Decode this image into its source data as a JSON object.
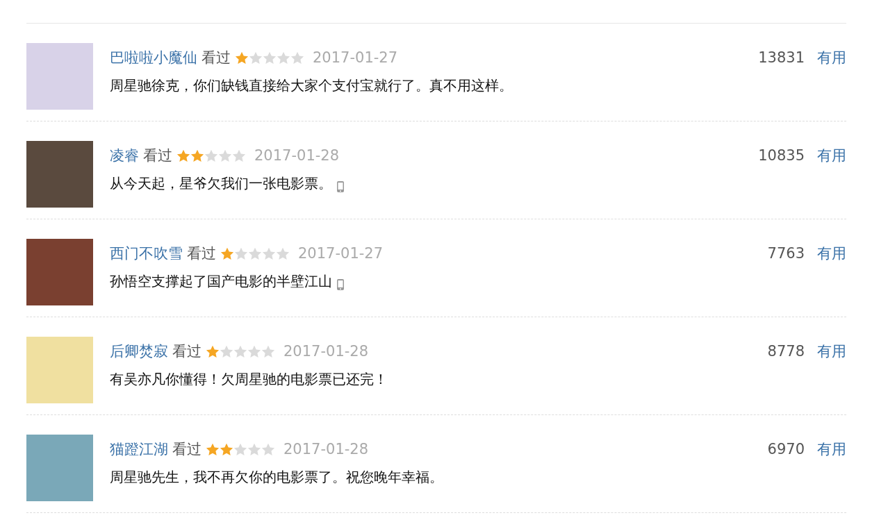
{
  "comments": [
    {
      "user": "巴啦啦小魔仙",
      "status": "看过",
      "stars": 1,
      "date": "2017-01-27",
      "votes": "13831",
      "useful": "有用",
      "text": "周星驰徐克，你们缺钱直接给大家个支付宝就行了。真不用这样。",
      "mobile": false
    },
    {
      "user": "凌睿",
      "status": "看过",
      "stars": 2,
      "date": "2017-01-28",
      "votes": "10835",
      "useful": "有用",
      "text": "从今天起，星爷欠我们一张电影票。",
      "mobile": true
    },
    {
      "user": "西门不吹雪",
      "status": "看过",
      "stars": 1,
      "date": "2017-01-27",
      "votes": "7763",
      "useful": "有用",
      "text": "孙悟空支撑起了国产电影的半壁江山",
      "mobile": true
    },
    {
      "user": "后卿焚寂",
      "status": "看过",
      "stars": 1,
      "date": "2017-01-28",
      "votes": "8778",
      "useful": "有用",
      "text": "有吴亦凡你懂得！欠周星驰的电影票已还完！",
      "mobile": false
    },
    {
      "user": "猫蹬江湖",
      "status": "看过",
      "stars": 2,
      "date": "2017-01-28",
      "votes": "6970",
      "useful": "有用",
      "text": "周星驰先生，我不再欠你的电影票了。祝您晚年幸福。",
      "mobile": false
    }
  ]
}
